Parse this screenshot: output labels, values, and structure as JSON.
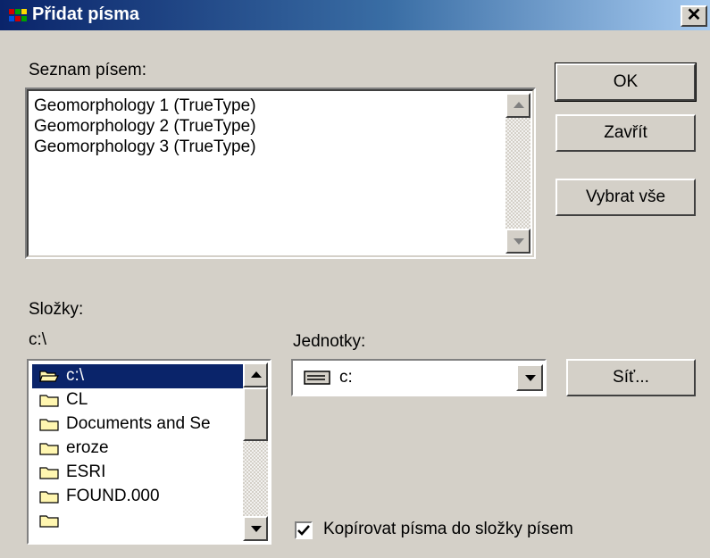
{
  "window": {
    "title": "Přidat písma"
  },
  "font_list": {
    "label": "Seznam písem:",
    "items": [
      "Geomorphology 1 (TrueType)",
      "Geomorphology 2  (TrueType)",
      "Geomorphology 3 (TrueType)"
    ]
  },
  "buttons": {
    "ok": "OK",
    "close": "Zavřít",
    "select_all": "Vybrat vše",
    "network": "Síť..."
  },
  "folders": {
    "label": "Složky:",
    "current_path": "c:\\",
    "items": [
      {
        "name": "c:\\",
        "selected": true,
        "open": true
      },
      {
        "name": "CL",
        "selected": false
      },
      {
        "name": "Documents and Se",
        "selected": false
      },
      {
        "name": "eroze",
        "selected": false
      },
      {
        "name": "ESRI",
        "selected": false
      },
      {
        "name": "FOUND.000",
        "selected": false
      }
    ]
  },
  "drives": {
    "label": "Jednotky:",
    "selected": "c:"
  },
  "copy_option": {
    "label": "Kopírovat písma do složky písem",
    "checked": true
  },
  "colors": {
    "title_start": "#0a246a",
    "title_end": "#a6caf0",
    "selection": "#0a246a",
    "face": "#d4d0c8"
  }
}
